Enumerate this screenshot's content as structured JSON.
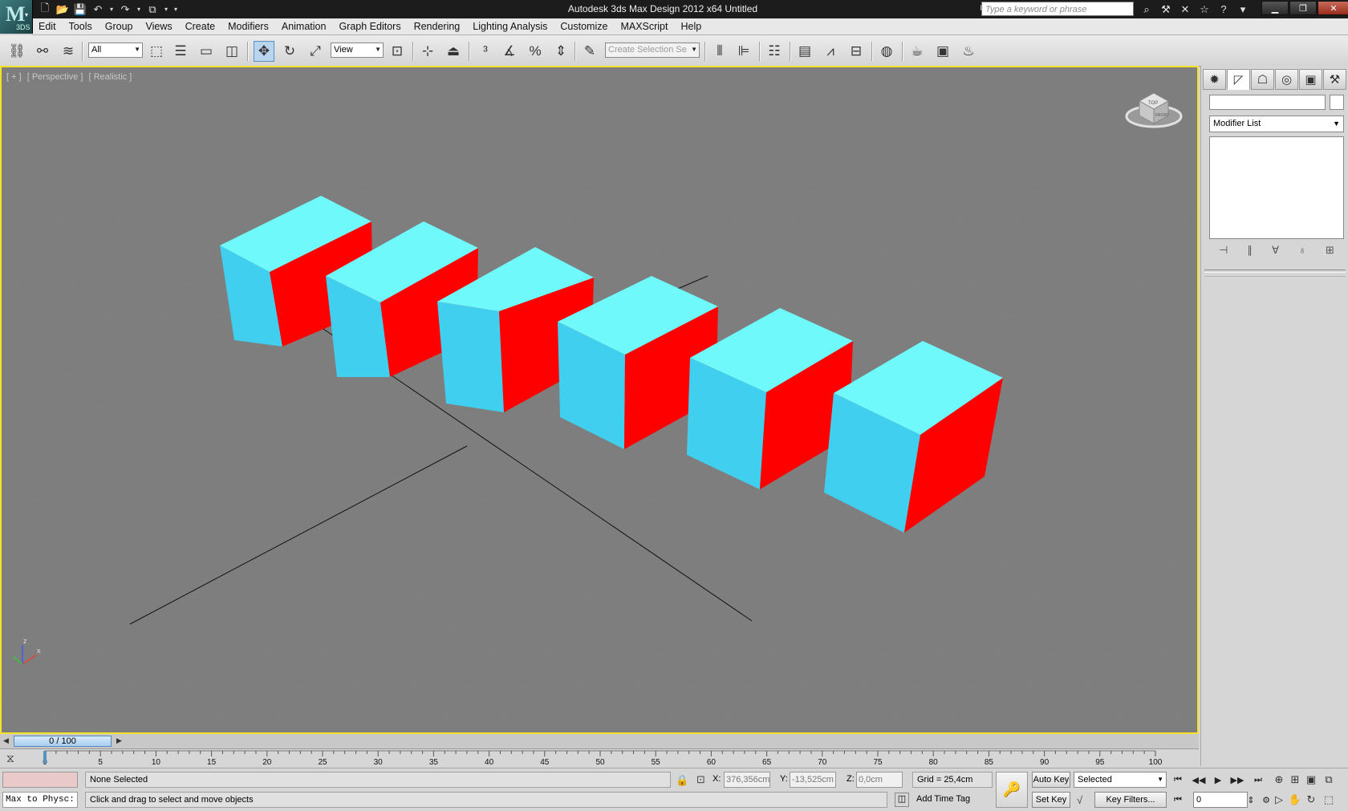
{
  "window": {
    "title": "Autodesk 3ds Max Design 2012 x64      Untitled",
    "app_version_badge": "3DS",
    "search_placeholder": "Type a keyword or phrase"
  },
  "menu": [
    "Edit",
    "Tools",
    "Group",
    "Views",
    "Create",
    "Modifiers",
    "Animation",
    "Graph Editors",
    "Rendering",
    "Lighting Analysis",
    "Customize",
    "MAXScript",
    "Help"
  ],
  "toolbar": {
    "selection_filter": "All",
    "reference_coord": "View",
    "named_selection_placeholder": "Create Selection Se"
  },
  "viewport": {
    "labels": [
      "[ + ]",
      "[ Perspective ]",
      "[ Realistic ]"
    ],
    "axis_z": "z",
    "axis_x": "x",
    "box_top_color": "#6ff9fa",
    "box_left_color": "#40cfee",
    "box_right_color": "#ff0000",
    "background_color": "#7e7e7e",
    "active_border_color": "#f3e12a",
    "viewcube_labels": [
      "TOP",
      "FRONT"
    ]
  },
  "command_panel": {
    "modifier_list": "Modifier List"
  },
  "timeline": {
    "slider_label": "0 / 100",
    "ticks": [
      0,
      5,
      10,
      15,
      20,
      25,
      30,
      35,
      40,
      45,
      50,
      55,
      60,
      65,
      70,
      75,
      80,
      85,
      90,
      95,
      100
    ]
  },
  "status": {
    "maxscript_output": "Max to Physc:",
    "selection": "None Selected",
    "prompt": "Click and drag to select and move objects",
    "x_label": "X:",
    "x_value": "376,356cm",
    "y_label": "Y:",
    "y_value": "-13,525cm",
    "z_label": "Z:",
    "z_value": "0,0cm",
    "grid": "Grid = 25,4cm",
    "add_time_tag": "Add Time Tag",
    "auto_key": "Auto Key",
    "set_key": "Set Key",
    "key_mode": "Selected",
    "key_filters": "Key Filters...",
    "current_frame": "0"
  }
}
